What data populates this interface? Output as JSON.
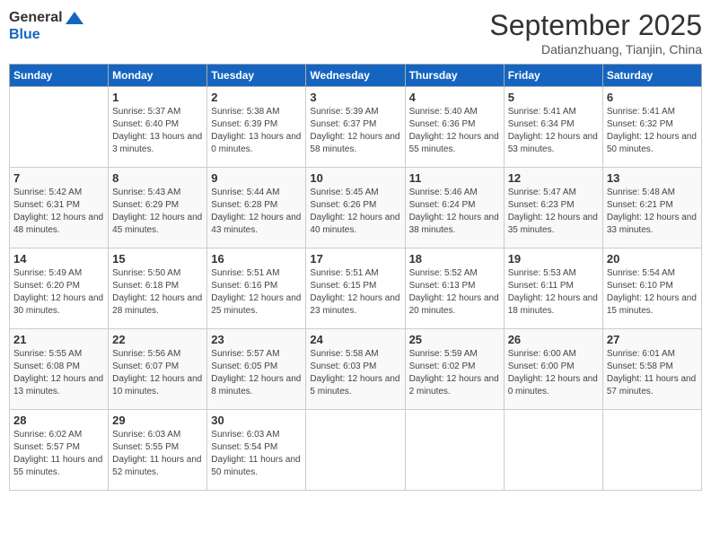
{
  "header": {
    "logo_line1": "General",
    "logo_line2": "Blue",
    "month": "September 2025",
    "location": "Datianzhuang, Tianjin, China"
  },
  "days_of_week": [
    "Sunday",
    "Monday",
    "Tuesday",
    "Wednesday",
    "Thursday",
    "Friday",
    "Saturday"
  ],
  "weeks": [
    [
      {
        "day": "",
        "info": ""
      },
      {
        "day": "1",
        "info": "Sunrise: 5:37 AM\nSunset: 6:40 PM\nDaylight: 13 hours\nand 3 minutes."
      },
      {
        "day": "2",
        "info": "Sunrise: 5:38 AM\nSunset: 6:39 PM\nDaylight: 13 hours\nand 0 minutes."
      },
      {
        "day": "3",
        "info": "Sunrise: 5:39 AM\nSunset: 6:37 PM\nDaylight: 12 hours\nand 58 minutes."
      },
      {
        "day": "4",
        "info": "Sunrise: 5:40 AM\nSunset: 6:36 PM\nDaylight: 12 hours\nand 55 minutes."
      },
      {
        "day": "5",
        "info": "Sunrise: 5:41 AM\nSunset: 6:34 PM\nDaylight: 12 hours\nand 53 minutes."
      },
      {
        "day": "6",
        "info": "Sunrise: 5:41 AM\nSunset: 6:32 PM\nDaylight: 12 hours\nand 50 minutes."
      }
    ],
    [
      {
        "day": "7",
        "info": "Sunrise: 5:42 AM\nSunset: 6:31 PM\nDaylight: 12 hours\nand 48 minutes."
      },
      {
        "day": "8",
        "info": "Sunrise: 5:43 AM\nSunset: 6:29 PM\nDaylight: 12 hours\nand 45 minutes."
      },
      {
        "day": "9",
        "info": "Sunrise: 5:44 AM\nSunset: 6:28 PM\nDaylight: 12 hours\nand 43 minutes."
      },
      {
        "day": "10",
        "info": "Sunrise: 5:45 AM\nSunset: 6:26 PM\nDaylight: 12 hours\nand 40 minutes."
      },
      {
        "day": "11",
        "info": "Sunrise: 5:46 AM\nSunset: 6:24 PM\nDaylight: 12 hours\nand 38 minutes."
      },
      {
        "day": "12",
        "info": "Sunrise: 5:47 AM\nSunset: 6:23 PM\nDaylight: 12 hours\nand 35 minutes."
      },
      {
        "day": "13",
        "info": "Sunrise: 5:48 AM\nSunset: 6:21 PM\nDaylight: 12 hours\nand 33 minutes."
      }
    ],
    [
      {
        "day": "14",
        "info": "Sunrise: 5:49 AM\nSunset: 6:20 PM\nDaylight: 12 hours\nand 30 minutes."
      },
      {
        "day": "15",
        "info": "Sunrise: 5:50 AM\nSunset: 6:18 PM\nDaylight: 12 hours\nand 28 minutes."
      },
      {
        "day": "16",
        "info": "Sunrise: 5:51 AM\nSunset: 6:16 PM\nDaylight: 12 hours\nand 25 minutes."
      },
      {
        "day": "17",
        "info": "Sunrise: 5:51 AM\nSunset: 6:15 PM\nDaylight: 12 hours\nand 23 minutes."
      },
      {
        "day": "18",
        "info": "Sunrise: 5:52 AM\nSunset: 6:13 PM\nDaylight: 12 hours\nand 20 minutes."
      },
      {
        "day": "19",
        "info": "Sunrise: 5:53 AM\nSunset: 6:11 PM\nDaylight: 12 hours\nand 18 minutes."
      },
      {
        "day": "20",
        "info": "Sunrise: 5:54 AM\nSunset: 6:10 PM\nDaylight: 12 hours\nand 15 minutes."
      }
    ],
    [
      {
        "day": "21",
        "info": "Sunrise: 5:55 AM\nSunset: 6:08 PM\nDaylight: 12 hours\nand 13 minutes."
      },
      {
        "day": "22",
        "info": "Sunrise: 5:56 AM\nSunset: 6:07 PM\nDaylight: 12 hours\nand 10 minutes."
      },
      {
        "day": "23",
        "info": "Sunrise: 5:57 AM\nSunset: 6:05 PM\nDaylight: 12 hours\nand 8 minutes."
      },
      {
        "day": "24",
        "info": "Sunrise: 5:58 AM\nSunset: 6:03 PM\nDaylight: 12 hours\nand 5 minutes."
      },
      {
        "day": "25",
        "info": "Sunrise: 5:59 AM\nSunset: 6:02 PM\nDaylight: 12 hours\nand 2 minutes."
      },
      {
        "day": "26",
        "info": "Sunrise: 6:00 AM\nSunset: 6:00 PM\nDaylight: 12 hours\nand 0 minutes."
      },
      {
        "day": "27",
        "info": "Sunrise: 6:01 AM\nSunset: 5:58 PM\nDaylight: 11 hours\nand 57 minutes."
      }
    ],
    [
      {
        "day": "28",
        "info": "Sunrise: 6:02 AM\nSunset: 5:57 PM\nDaylight: 11 hours\nand 55 minutes."
      },
      {
        "day": "29",
        "info": "Sunrise: 6:03 AM\nSunset: 5:55 PM\nDaylight: 11 hours\nand 52 minutes."
      },
      {
        "day": "30",
        "info": "Sunrise: 6:03 AM\nSunset: 5:54 PM\nDaylight: 11 hours\nand 50 minutes."
      },
      {
        "day": "",
        "info": ""
      },
      {
        "day": "",
        "info": ""
      },
      {
        "day": "",
        "info": ""
      },
      {
        "day": "",
        "info": ""
      }
    ]
  ]
}
